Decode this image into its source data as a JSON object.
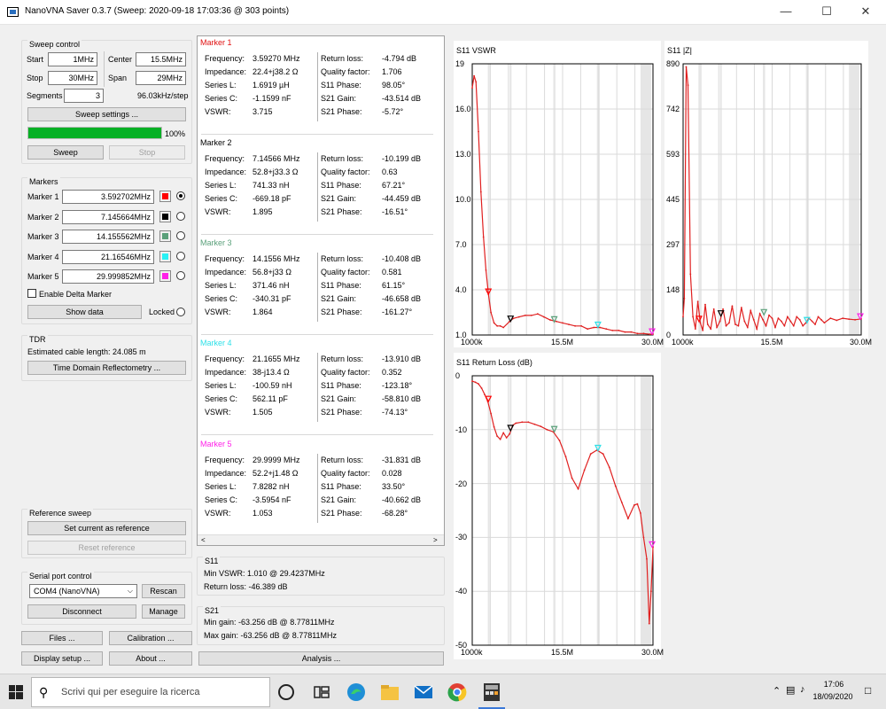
{
  "window": {
    "title": "NanoVNA Saver 0.3.7 (Sweep: 2020-09-18 17:03:36 @ 303 points)"
  },
  "sweep_control": {
    "title": "Sweep control",
    "start_label": "Start",
    "start_value": "1MHz",
    "center_label": "Center",
    "center_value": "15.5MHz",
    "stop_label": "Stop",
    "stop_value": "30MHz",
    "span_label": "Span",
    "span_value": "29MHz",
    "segments_label": "Segments",
    "segments_value": "3",
    "step_text": "96.03kHz/step",
    "settings_button": "Sweep settings ...",
    "progress": 100,
    "progress_text": "100%",
    "sweep_button": "Sweep",
    "stop_button": "Stop"
  },
  "markers_group": {
    "title": "Markers",
    "items": [
      {
        "label": "Marker 1",
        "value": "3.592702MHz",
        "color": "#ff0000",
        "selected": true
      },
      {
        "label": "Marker 2",
        "value": "7.145664MHz",
        "color": "#000000",
        "selected": false
      },
      {
        "label": "Marker 3",
        "value": "14.155562MHz",
        "color": "#5aa07a",
        "selected": false
      },
      {
        "label": "Marker 4",
        "value": "21.16546MHz",
        "color": "#29f1f5",
        "selected": false
      },
      {
        "label": "Marker 5",
        "value": "29.999852MHz",
        "color": "#ff20e8",
        "selected": false
      }
    ],
    "delta_label": "Enable Delta Marker",
    "show_data_button": "Show data",
    "locked_label": "Locked"
  },
  "tdr": {
    "title": "TDR",
    "cable_text": "Estimated cable length:  24.085 m",
    "button": "Time Domain Reflectometry ..."
  },
  "reference": {
    "title": "Reference sweep",
    "set_button": "Set current as reference",
    "reset_button": "Reset reference"
  },
  "serial": {
    "title": "Serial port control",
    "port": "COM4 (NanoVNA)",
    "rescan": "Rescan",
    "disconnect": "Disconnect",
    "manage": "Manage"
  },
  "bottom_buttons": {
    "files": "Files ...",
    "calibration": "Calibration ...",
    "display": "Display setup ...",
    "about": "About ...",
    "analysis": "Analysis ..."
  },
  "marker_details": [
    {
      "title": "Marker 1",
      "color": "#e01010",
      "left": [
        [
          "Frequency:",
          "3.59270 MHz"
        ],
        [
          "Impedance:",
          "22.4+j38.2 Ω"
        ],
        [
          "Series L:",
          "1.6919 µH"
        ],
        [
          "Series C:",
          "-1.1599 nF"
        ],
        [
          "VSWR:",
          "3.715"
        ]
      ],
      "right": [
        [
          "Return loss:",
          "-4.794 dB"
        ],
        [
          "Quality factor:",
          "1.706"
        ],
        [
          "S11 Phase:",
          "98.05°"
        ],
        [
          "S21 Gain:",
          "-43.514 dB"
        ],
        [
          "S21 Phase:",
          "-5.72°"
        ]
      ]
    },
    {
      "title": "Marker 2",
      "color": "#000000",
      "left": [
        [
          "Frequency:",
          "7.14566 MHz"
        ],
        [
          "Impedance:",
          "52.8+j33.3 Ω"
        ],
        [
          "Series L:",
          "741.33 nH"
        ],
        [
          "Series C:",
          "-669.18 pF"
        ],
        [
          "VSWR:",
          "1.895"
        ]
      ],
      "right": [
        [
          "Return loss:",
          "-10.199 dB"
        ],
        [
          "Quality factor:",
          "0.63"
        ],
        [
          "S11 Phase:",
          "67.21°"
        ],
        [
          "S21 Gain:",
          "-44.459 dB"
        ],
        [
          "S21 Phase:",
          "-16.51°"
        ]
      ]
    },
    {
      "title": "Marker 3",
      "color": "#5aa07a",
      "left": [
        [
          "Frequency:",
          "14.1556 MHz"
        ],
        [
          "Impedance:",
          "56.8+j33 Ω"
        ],
        [
          "Series L:",
          "371.46 nH"
        ],
        [
          "Series C:",
          "-340.31 pF"
        ],
        [
          "VSWR:",
          "1.864"
        ]
      ],
      "right": [
        [
          "Return loss:",
          "-10.408 dB"
        ],
        [
          "Quality factor:",
          "0.581"
        ],
        [
          "S11 Phase:",
          "61.15°"
        ],
        [
          "S21 Gain:",
          "-46.658 dB"
        ],
        [
          "S21 Phase:",
          "-161.27°"
        ]
      ]
    },
    {
      "title": "Marker 4",
      "color": "#2de0e8",
      "left": [
        [
          "Frequency:",
          "21.1655 MHz"
        ],
        [
          "Impedance:",
          "38-j13.4 Ω"
        ],
        [
          "Series L:",
          "-100.59 nH"
        ],
        [
          "Series C:",
          "562.11 pF"
        ],
        [
          "VSWR:",
          "1.505"
        ]
      ],
      "right": [
        [
          "Return loss:",
          "-13.910 dB"
        ],
        [
          "Quality factor:",
          "0.352"
        ],
        [
          "S11 Phase:",
          "-123.18°"
        ],
        [
          "S21 Gain:",
          "-58.810 dB"
        ],
        [
          "S21 Phase:",
          "-74.13°"
        ]
      ]
    },
    {
      "title": "Marker 5",
      "color": "#ff20e8",
      "left": [
        [
          "Frequency:",
          "29.9999 MHz"
        ],
        [
          "Impedance:",
          "52.2+j1.48 Ω"
        ],
        [
          "Series L:",
          "7.8282 nH"
        ],
        [
          "Series C:",
          "-3.5954 nF"
        ],
        [
          "VSWR:",
          "1.053"
        ]
      ],
      "right": [
        [
          "Return loss:",
          "-31.831 dB"
        ],
        [
          "Quality factor:",
          "0.028"
        ],
        [
          "S11 Phase:",
          "33.50°"
        ],
        [
          "S21 Gain:",
          "-40.662 dB"
        ],
        [
          "S21 Phase:",
          "-68.28°"
        ]
      ]
    }
  ],
  "s11_summary": {
    "title": "S11",
    "min_vswr": "Min VSWR:     1.010 @ 29.4237MHz",
    "return_loss": "Return loss:   -46.389 dB"
  },
  "s21_summary": {
    "title": "S21",
    "min_gain": "Min gain:   -63.256 dB @ 8.77811MHz",
    "max_gain": "Max gain:   -63.256 dB @ 8.77811MHz"
  },
  "taskbar": {
    "search_placeholder": "Scrivi qui per eseguire la ricerca",
    "time": "17:06",
    "date": "18/09/2020"
  },
  "chart_data": [
    {
      "type": "line",
      "title": "S11 VSWR",
      "ylim": [
        1,
        19
      ],
      "yticks": [
        "19",
        "16.0",
        "13.0",
        "10.0",
        "7.0",
        "4.0",
        "1.0"
      ],
      "xlim": [
        1,
        30
      ],
      "xticks": [
        "1000k",
        "15.5M",
        "30.0M"
      ],
      "series": [
        {
          "color": "#e02020",
          "x": [
            1,
            1.3,
            1.6,
            2,
            2.4,
            2.8,
            3.2,
            3.6,
            4,
            4.5,
            5,
            5.5,
            6,
            7,
            7.6,
            8.5,
            9.5,
            10.5,
            11.5,
            12.5,
            13.5,
            14.5,
            15.5,
            16.5,
            17.5,
            18.5,
            19.5,
            20.5,
            21.5,
            22.5,
            23.5,
            24.5,
            25.5,
            26.5,
            27.5,
            28.5,
            29.5,
            30
          ],
          "y": [
            17.4,
            18.2,
            17.8,
            14.5,
            10.5,
            7.5,
            5.3,
            3.7,
            2.5,
            1.8,
            1.6,
            1.6,
            1.5,
            1.9,
            2.1,
            2.2,
            2.3,
            2.3,
            2.4,
            2.2,
            2.0,
            1.9,
            1.8,
            1.7,
            1.6,
            1.6,
            1.4,
            1.5,
            1.5,
            1.4,
            1.3,
            1.3,
            1.2,
            1.2,
            1.1,
            1.1,
            1.05,
            1.05
          ]
        }
      ],
      "markers": [
        {
          "x": 3.59,
          "y": 3.7,
          "color": "#ff0000"
        },
        {
          "x": 7.15,
          "y": 1.9,
          "color": "#000000"
        },
        {
          "x": 14.16,
          "y": 1.86,
          "color": "#5aa07a"
        },
        {
          "x": 21.17,
          "y": 1.5,
          "color": "#2de0e8"
        },
        {
          "x": 30,
          "y": 1.05,
          "color": "#ff20e8"
        }
      ]
    },
    {
      "type": "line",
      "title": "S11 |Z|",
      "ylim": [
        0,
        890
      ],
      "yticks": [
        "890",
        "742",
        "593",
        "445",
        "297",
        "148",
        "0"
      ],
      "xlim": [
        1,
        30
      ],
      "xticks": [
        "1000k",
        "15.5M",
        "30.0M"
      ],
      "series": [
        {
          "color": "#e02020",
          "x": [
            1,
            1.2,
            1.5,
            1.8,
            2.2,
            2.6,
            3,
            3.4,
            3.8,
            4.2,
            4.6,
            5,
            5.5,
            6,
            6.5,
            7,
            7.5,
            8,
            8.5,
            9,
            9.5,
            10,
            10.5,
            11,
            11.5,
            12,
            12.5,
            13,
            13.5,
            14,
            14.5,
            15,
            15.5,
            16,
            16.5,
            17,
            17.5,
            18,
            18.5,
            19,
            19.5,
            20,
            20.5,
            21,
            21.5,
            22,
            22.5,
            23,
            23.5,
            24,
            25,
            26,
            27,
            28,
            29,
            30
          ],
          "y": [
            60,
            120,
            880,
            820,
            200,
            60,
            20,
            110,
            40,
            15,
            100,
            35,
            20,
            85,
            25,
            45,
            85,
            30,
            40,
            95,
            35,
            30,
            90,
            45,
            25,
            80,
            50,
            20,
            70,
            50,
            30,
            65,
            55,
            25,
            55,
            45,
            30,
            60,
            45,
            30,
            60,
            50,
            30,
            40,
            55,
            45,
            35,
            60,
            50,
            40,
            55,
            48,
            55,
            52,
            50,
            53
          ]
        }
      ],
      "markers": [
        {
          "x": 3.59,
          "y": 44,
          "color": "#ff0000"
        },
        {
          "x": 7.15,
          "y": 62,
          "color": "#000000"
        },
        {
          "x": 14.16,
          "y": 66,
          "color": "#5aa07a"
        },
        {
          "x": 21.17,
          "y": 40,
          "color": "#2de0e8"
        },
        {
          "x": 30,
          "y": 52,
          "color": "#ff20e8"
        }
      ]
    },
    {
      "type": "line",
      "title": "S11 Return Loss (dB)",
      "ylim": [
        -50,
        0
      ],
      "yticks": [
        "0",
        "-10",
        "-20",
        "-30",
        "-40",
        "-50"
      ],
      "xlim": [
        1,
        30
      ],
      "xticks": [
        "1000k",
        "15.5M",
        "30.0M"
      ],
      "series": [
        {
          "color": "#e02020",
          "x": [
            1,
            1.5,
            2,
            2.5,
            3,
            3.5,
            4,
            4.5,
            5,
            5.5,
            6,
            6.5,
            7,
            7.5,
            8,
            9,
            10,
            11,
            12,
            13,
            14,
            15,
            16,
            17,
            18,
            19,
            20,
            21,
            22,
            23,
            24,
            25,
            26,
            27,
            27.5,
            28,
            28.5,
            29,
            29.4,
            29.7,
            30
          ],
          "y": [
            -1,
            -1.2,
            -1.5,
            -2.3,
            -3.5,
            -4.8,
            -7,
            -9.5,
            -11.2,
            -11.8,
            -10.6,
            -11.5,
            -10.8,
            -9.2,
            -8.8,
            -8.6,
            -8.6,
            -9,
            -9.4,
            -10,
            -10.4,
            -12,
            -15,
            -19,
            -21,
            -17.5,
            -14.5,
            -13.8,
            -14.5,
            -17,
            -20.5,
            -23.5,
            -26.5,
            -24,
            -23.8,
            -25.5,
            -30,
            -34,
            -46,
            -40,
            -31.8
          ]
        }
      ],
      "markers": [
        {
          "x": 3.59,
          "y": -4.8,
          "color": "#ff0000"
        },
        {
          "x": 7.15,
          "y": -10.2,
          "color": "#000000"
        },
        {
          "x": 14.16,
          "y": -10.4,
          "color": "#5aa07a"
        },
        {
          "x": 21.17,
          "y": -13.9,
          "color": "#2de0e8"
        },
        {
          "x": 30,
          "y": -31.8,
          "color": "#ff20e8"
        }
      ]
    }
  ]
}
